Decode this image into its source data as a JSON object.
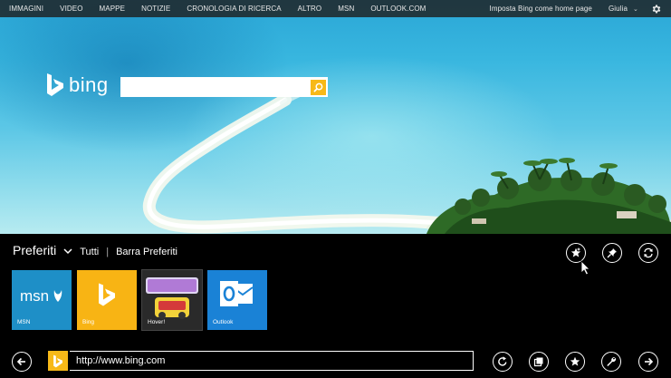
{
  "nav": {
    "items": [
      "IMMAGINI",
      "VIDEO",
      "MAPPE",
      "NOTIZIE",
      "CRONOLOGIA DI RICERCA",
      "ALTRO",
      "MSN",
      "OUTLOOK.COM"
    ],
    "home_link": "Imposta Bing come home page",
    "user": "Giulia",
    "user_caret": "⌄",
    "settings_icon": "gear-icon"
  },
  "bing": {
    "logo_text": "bing",
    "search_value": "",
    "search_icon": "search-icon"
  },
  "favorites": {
    "title": "Preferiti",
    "filter_all": "Tutti",
    "separator": "|",
    "filter_bar": "Barra Preferiti",
    "tiles": [
      {
        "label": "MSN",
        "color": "#1e8fc7"
      },
      {
        "label": "Bing",
        "color": "#f8b414"
      },
      {
        "label": "Hover!",
        "color": "#2b2b2b"
      },
      {
        "label": "Outlook",
        "color": "#1a82d6"
      }
    ],
    "actions": [
      "add-favorite-icon",
      "pin-icon",
      "sync-icon"
    ]
  },
  "appbar": {
    "url": "http://www.bing.com",
    "buttons": [
      "back-icon",
      "refresh-icon",
      "tabs-icon",
      "favorites-icon",
      "tools-icon",
      "forward-icon"
    ]
  },
  "colors": {
    "accent": "#f7b918",
    "background": "#000000"
  }
}
